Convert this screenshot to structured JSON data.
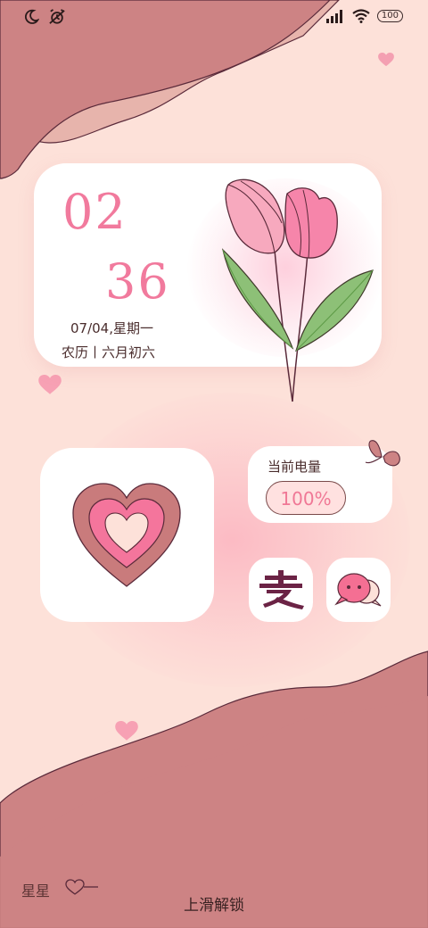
{
  "status_bar": {
    "battery_level": "100",
    "icons": [
      "moon-icon",
      "alarm-off-icon",
      "signal-icon",
      "wifi-icon",
      "battery-icon"
    ]
  },
  "clock_widget": {
    "hour": "02",
    "minute": "36",
    "date": "07/04,星期一",
    "lunar": "农历丨六月初六"
  },
  "battery_widget": {
    "title": "当前电量",
    "percent_text": "100%",
    "level": 1.0
  },
  "apps": [
    {
      "name": "alipay-icon",
      "glyph": "支"
    },
    {
      "name": "chat-bubble-icon"
    }
  ],
  "footer": {
    "left_label": "星星",
    "unlock_hint": "上滑解锁"
  },
  "colors": {
    "background": "#fde1d9",
    "wave_dark": "#cd8384",
    "wave_light": "#e6b2aa",
    "accent_pink": "#f17a9d",
    "text_dark": "#4a2d2d"
  }
}
